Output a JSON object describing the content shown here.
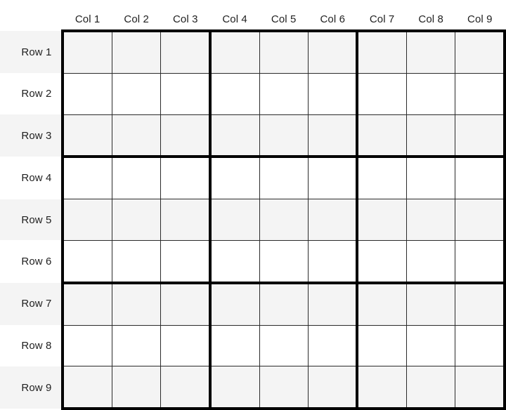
{
  "grid": {
    "title": "",
    "corner_label": "",
    "column_headers": [
      "Col 1",
      "Col 2",
      "Col 3",
      "Col 4",
      "Col 5",
      "Col 6",
      "Col 7",
      "Col 8",
      "Col 9"
    ],
    "row_headers": [
      "Row 1",
      "Row 2",
      "Row 3",
      "Row 4",
      "Row 5",
      "Row 6",
      "Row 7",
      "Row 8",
      "Row 9"
    ],
    "rows": 9,
    "cols": 9,
    "block_size": 3,
    "cell_values": [
      [
        "",
        "",
        "",
        "",
        "",
        "",
        "",
        "",
        ""
      ],
      [
        "",
        "",
        "",
        "",
        "",
        "",
        "",
        "",
        ""
      ],
      [
        "",
        "",
        "",
        "",
        "",
        "",
        "",
        "",
        ""
      ],
      [
        "",
        "",
        "",
        "",
        "",
        "",
        "",
        "",
        ""
      ],
      [
        "",
        "",
        "",
        "",
        "",
        "",
        "",
        "",
        ""
      ],
      [
        "",
        "",
        "",
        "",
        "",
        "",
        "",
        "",
        ""
      ],
      [
        "",
        "",
        "",
        "",
        "",
        "",
        "",
        "",
        ""
      ],
      [
        "",
        "",
        "",
        "",
        "",
        "",
        "",
        "",
        ""
      ],
      [
        "",
        "",
        "",
        "",
        "",
        "",
        "",
        "",
        ""
      ]
    ],
    "colors": {
      "page_background": "#ffffff",
      "cell_background": "#ffffff",
      "stripe_background": "#f4f4f4",
      "thin_line": "#2b2b2b",
      "thick_line": "#000000",
      "label_text": "#1f1f1f"
    }
  }
}
